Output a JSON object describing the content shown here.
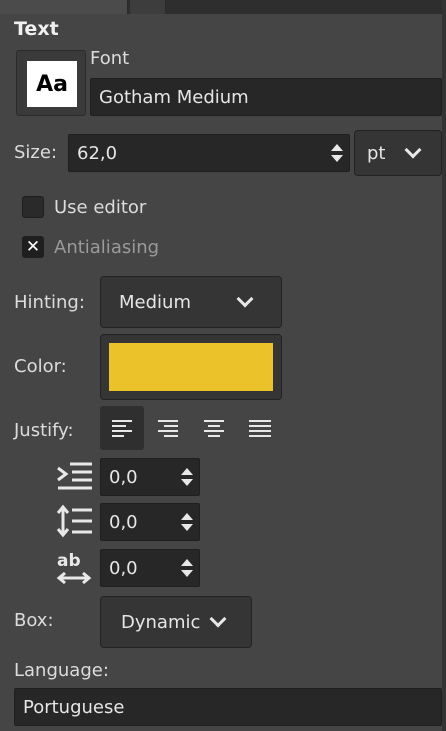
{
  "panel": {
    "title": "Text",
    "font": {
      "label": "Font",
      "preview_glyph": "Aa",
      "value": "Gotham Medium"
    },
    "size": {
      "label": "Size:",
      "value": "62,0",
      "unit": "pt"
    },
    "use_editor": {
      "label": "Use editor",
      "checked": false
    },
    "antialiasing": {
      "label": "Antialiasing",
      "checked": true,
      "check_glyph": "✕"
    },
    "hinting": {
      "label": "Hinting:",
      "value": "Medium"
    },
    "color": {
      "label": "Color:",
      "swatch": "#ecc22a"
    },
    "justify": {
      "label": "Justify:",
      "options": [
        "left",
        "right",
        "center",
        "fill"
      ],
      "selected": "left"
    },
    "indent": {
      "value": "0,0"
    },
    "line_spacing": {
      "value": "0,0"
    },
    "letter_spacing": {
      "value": "0,0"
    },
    "box": {
      "label": "Box:",
      "value": "Dynamic"
    },
    "language": {
      "label": "Language:",
      "value": "Portuguese"
    }
  },
  "colors": {
    "background": "#454545",
    "entry_background": "#272727",
    "text": "#e2e2e2",
    "disabled_text": "#9a9a9a"
  }
}
